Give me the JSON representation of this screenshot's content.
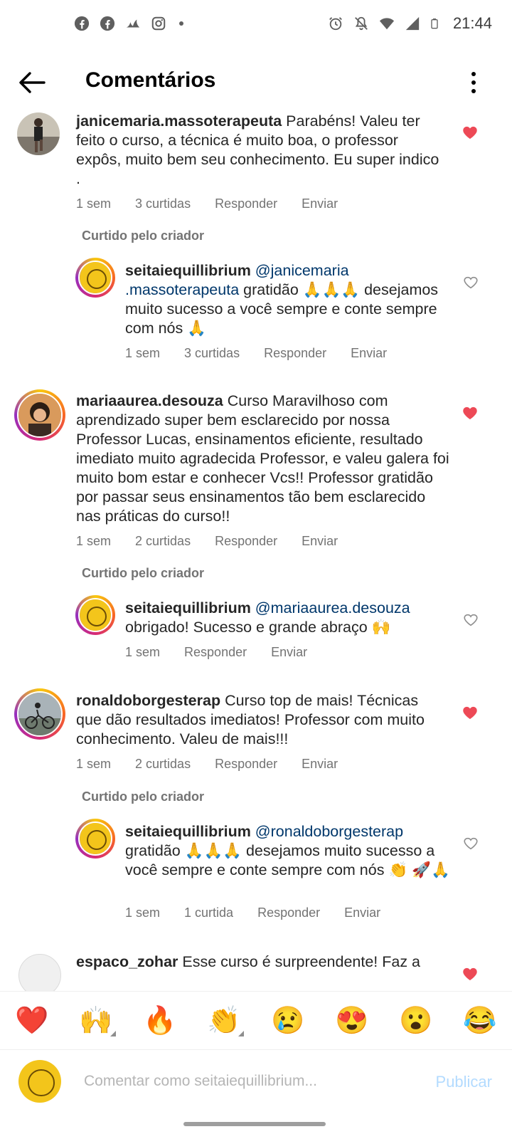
{
  "status_bar": {
    "time": "21:44",
    "left_icons": [
      "facebook-icon",
      "facebook-icon",
      "app-icon",
      "instagram-icon",
      "dot-icon"
    ],
    "right_icons": [
      "alarm-icon",
      "mute-icon",
      "wifi-icon",
      "signal-icon",
      "battery-icon"
    ]
  },
  "header": {
    "title": "Comentários"
  },
  "liked_by_creator_label": "Curtido pelo criador",
  "comments": [
    {
      "username": "janicemaria.massoterapeuta",
      "text": " Parabéns! Valeu ter feito o curso, a técnica é muito boa, o professor expôs,  muito bem seu conhecimento. Eu super indico .",
      "time": "1 sem",
      "likes": "3 curtidas",
      "reply": "Responder",
      "send": "Enviar",
      "liked": true
    },
    {
      "username": "seitaiequillibrium",
      "mention": " @janicemaria .massoterapeuta",
      "text": " gratidão 🙏🙏🙏 desejamos muito sucesso a você sempre e conte sempre com nós 🙏",
      "time": "1 sem",
      "likes": "3 curtidas",
      "reply": "Responder",
      "send": "Enviar",
      "liked": false
    },
    {
      "username": "mariaaurea.desouza",
      "text": " Curso Maravilhoso com aprendizado super bem esclarecido por nossa Professor Lucas, ensinamentos eficiente, resultado imediato muito agradecida Professor, e valeu galera foi muito bom estar e conhecer Vcs!! Professor gratidão por passar seus ensinamentos tão bem esclarecido nas práticas do curso!!",
      "time": "1 sem",
      "likes": "2 curtidas",
      "reply": "Responder",
      "send": "Enviar",
      "liked": true
    },
    {
      "username": "seitaiequillibrium",
      "mention": " @mariaaurea.desouza",
      "text": " obrigado! Sucesso e grande abraço 🙌",
      "time": "1 sem",
      "reply": "Responder",
      "send": "Enviar",
      "liked": false
    },
    {
      "username": "ronaldoborgesterap",
      "text": " Curso top de mais! Técnicas que dão resultados imediatos!  Professor com muito conhecimento. Valeu de mais!!!",
      "time": "1 sem",
      "likes": "2 curtidas",
      "reply": "Responder",
      "send": "Enviar",
      "liked": true
    },
    {
      "username": "seitaiequillibrium",
      "mention": " @ronaldoborgesterap",
      "text": " gratidão 🙏🙏🙏 desejamos muito sucesso a você sempre e conte sempre com nós 👏 🚀🙏",
      "time": "1 sem",
      "likes": "1 curtida",
      "reply": "Responder",
      "send": "Enviar",
      "liked": false
    },
    {
      "username": "espaco_zohar",
      "text": " Esse curso é surpreendente! Faz a",
      "liked": true
    }
  ],
  "emoji_bar": [
    "❤️",
    "🙌",
    "🔥",
    "👏",
    "😢",
    "😍",
    "😮",
    "😂"
  ],
  "input_bar": {
    "placeholder": "Comentar como seitaiequillibrium...",
    "publish_label": "Publicar"
  },
  "colors": {
    "like_red": "#ed4956",
    "mention_blue": "#00376b",
    "publish_disabled": "#b3dbff",
    "meta_gray": "#737373"
  }
}
